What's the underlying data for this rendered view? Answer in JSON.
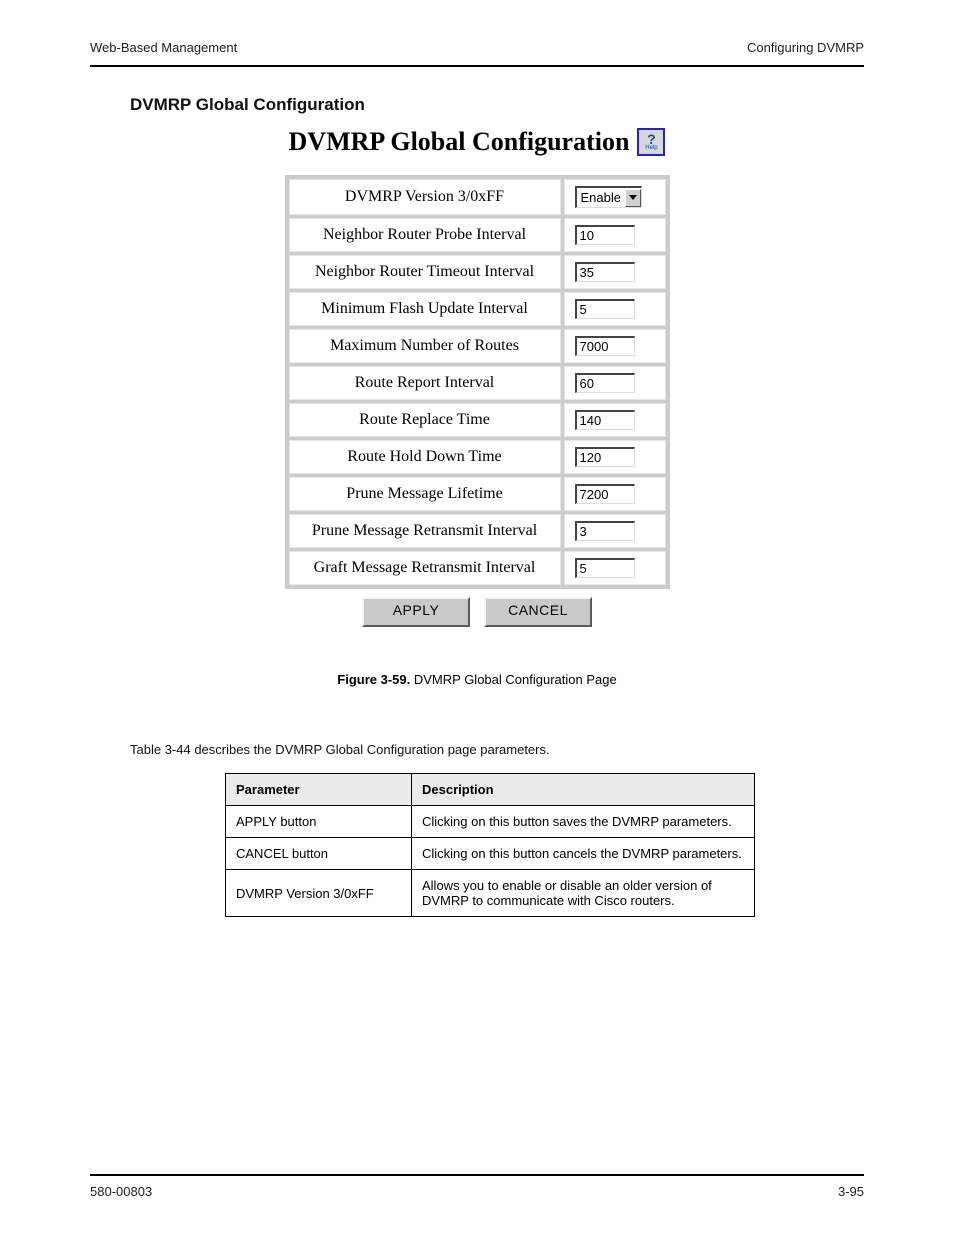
{
  "header": {
    "left": "Web-Based Management",
    "right": "Configuring DVMRP"
  },
  "section_label": "DVMRP Global Configuration",
  "page_title": "DVMRP Global Configuration",
  "help_icon": {
    "q": "?",
    "label": "Help"
  },
  "config": {
    "rows": [
      {
        "label": "DVMRP Version 3/0xFF",
        "type": "select",
        "value": "Enable"
      },
      {
        "label": "Neighbor Router Probe Interval",
        "type": "text",
        "value": "10"
      },
      {
        "label": "Neighbor Router Timeout Interval",
        "type": "text",
        "value": "35"
      },
      {
        "label": "Minimum Flash Update Interval",
        "type": "text",
        "value": "5"
      },
      {
        "label": "Maximum Number of Routes",
        "type": "text",
        "value": "7000"
      },
      {
        "label": "Route Report Interval",
        "type": "text",
        "value": "60"
      },
      {
        "label": "Route Replace Time",
        "type": "text",
        "value": "140"
      },
      {
        "label": "Route Hold Down Time",
        "type": "text",
        "value": "120"
      },
      {
        "label": "Prune Message Lifetime",
        "type": "text",
        "value": "7200"
      },
      {
        "label": "Prune Message Retransmit Interval",
        "type": "text",
        "value": "3"
      },
      {
        "label": "Graft Message Retransmit Interval",
        "type": "text",
        "value": "5"
      }
    ]
  },
  "buttons": {
    "apply": "APPLY",
    "cancel": "CANCEL"
  },
  "figure": {
    "number": "Figure 3-59.",
    "caption": "DVMRP Global Configuration Page"
  },
  "description_line": "Table 3-44 describes the DVMRP Global Configuration page parameters.",
  "param_table": {
    "headers": {
      "col1": "Parameter",
      "col2": "Description"
    },
    "rows": [
      {
        "name": "APPLY button",
        "desc": "Clicking on this button saves the DVMRP parameters."
      },
      {
        "name": "CANCEL button",
        "desc": "Clicking on this button cancels the DVMRP parameters."
      },
      {
        "name": "DVMRP Version 3/0xFF",
        "desc": "Allows you to enable or disable an older version of DVMRP to communicate with Cisco routers."
      }
    ]
  },
  "footer": {
    "left": "580-00803",
    "right": "3-95"
  }
}
